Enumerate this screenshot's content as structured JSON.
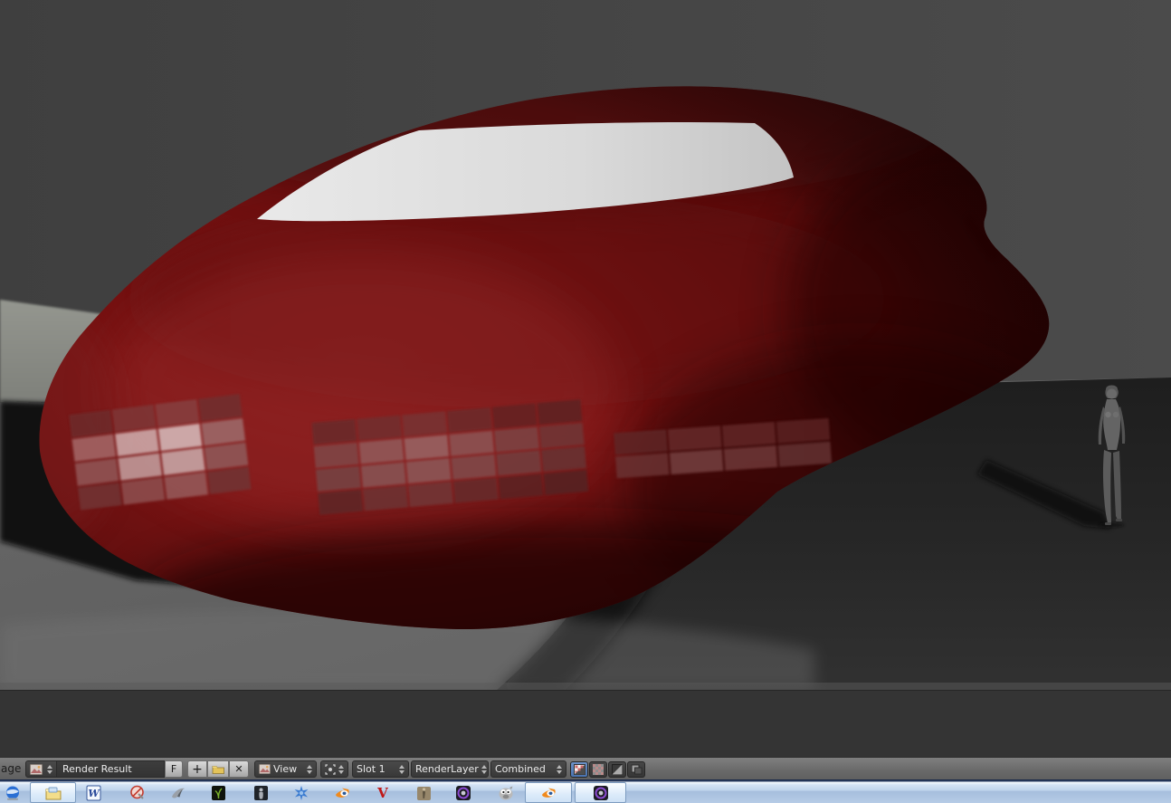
{
  "scene": {
    "colors": {
      "backdrop": "#474747",
      "body_red": "#7a1515",
      "body_dark_edge": "#2b0505",
      "windshield": "#dcdcdc",
      "floor_lit": "#616161",
      "floor_shaded": "#262626",
      "cast_shadow": "#0b0b0b",
      "figure_gray": "#5e5e5e"
    }
  },
  "header": {
    "menu_partial": "age",
    "datablock_value": "Render Result",
    "fake_user": "F",
    "new_glyph": "+",
    "unlink_glyph": "✕",
    "view_label": "View",
    "slot_value": "Slot 1",
    "layer_value": "RenderLayer",
    "pass_value": "Combined",
    "active_toggle_color": "#4a72ad"
  },
  "taskbar": {
    "items": [
      "google-earth",
      "explorer-folder-window",
      "word",
      "media-blocked",
      "swoosh-app",
      "plant-app",
      "figurine-app",
      "blue-star-app",
      "blender",
      "v-app",
      "tan-figure-app",
      "purple-lens-app",
      "gimp",
      "blender-window",
      "purple-lens-window"
    ]
  }
}
